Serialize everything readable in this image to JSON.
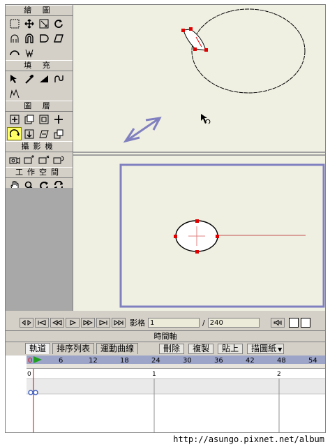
{
  "toolbox": {
    "sections": [
      {
        "title": "繪 圖",
        "tools": [
          [
            "rect-select-icon",
            "move-icon",
            "scale-icon",
            "rotate-icon"
          ],
          [
            "brush-icon",
            "magnet-icon",
            "shape-icon",
            "skew-icon"
          ],
          [
            "arc-icon",
            "warp-icon"
          ]
        ]
      },
      {
        "title": "填 充",
        "tools": [
          [
            "pick-icon",
            "eyedropper-icon",
            "wedge-icon",
            "curve-icon"
          ],
          [
            "stroke-icon"
          ]
        ]
      },
      {
        "title": "圖 層",
        "tools": [
          [
            "layer-add-icon",
            "layer-copy-icon",
            "layer-group-icon",
            "plus-icon"
          ],
          [
            "rotate-layer-icon",
            "layer-down-icon",
            "layer-skew-icon",
            "layer-stack-icon"
          ]
        ]
      },
      {
        "title": "攝影機",
        "tools": [
          [
            "camera-icon",
            "camera-move-icon",
            "camera-zoom-icon",
            "camera-rotate-icon"
          ]
        ]
      },
      {
        "title": "工作空間",
        "tools": [
          [
            "hand-icon",
            "zoom-icon",
            "rotate-view-icon",
            "reset-view-icon"
          ]
        ]
      }
    ]
  },
  "playback": {
    "frame_label": "影格",
    "frame_value": "1",
    "separator": "/",
    "total_frames": "240"
  },
  "timeline": {
    "title": "時間軸",
    "tabs": [
      "軌道",
      "排序列表",
      "運動曲線"
    ],
    "buttons": [
      "刪除",
      "複製",
      "貼上",
      "描圖紙"
    ],
    "ruler_ticks": [
      "0",
      "6",
      "12",
      "18",
      "24",
      "30",
      "36",
      "42",
      "48",
      "54"
    ],
    "sec_ticks": [
      "0",
      "1",
      "2"
    ]
  },
  "footer": {
    "url": "http://asungo.pixnet.net/album"
  },
  "colors": {
    "canvas_bg": "#efefe2",
    "accent": "#8080c0",
    "handle": "#e00000"
  }
}
